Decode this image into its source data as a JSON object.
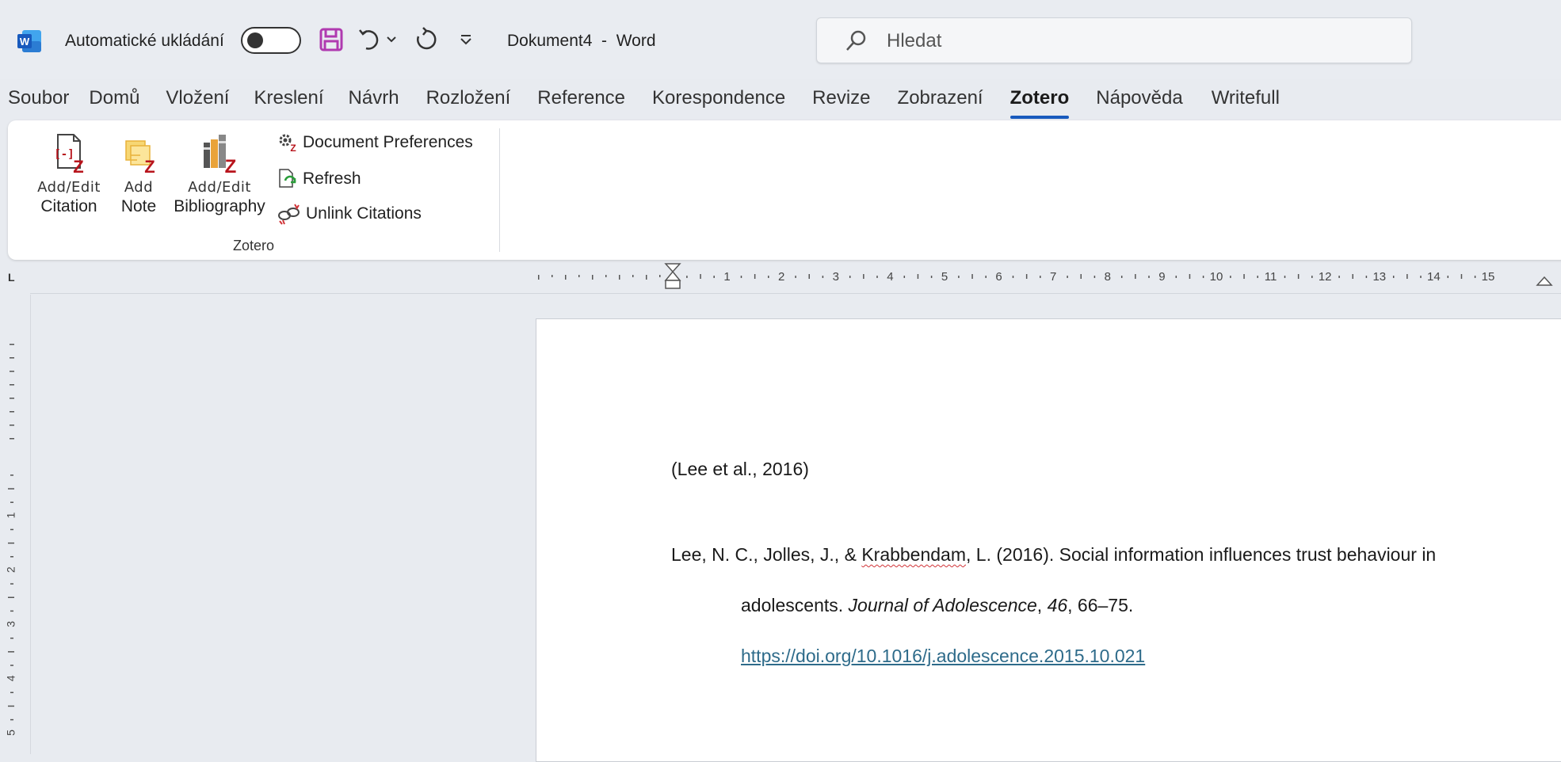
{
  "titlebar": {
    "autosave_label": "Automatické ukládání",
    "document_title": "Dokument4  -  Word",
    "search_placeholder": "Hledat"
  },
  "tabs": [
    {
      "label": "Soubor"
    },
    {
      "label": "Domů"
    },
    {
      "label": "Vložení"
    },
    {
      "label": "Kreslení"
    },
    {
      "label": "Návrh"
    },
    {
      "label": "Rozložení"
    },
    {
      "label": "Reference"
    },
    {
      "label": "Korespondence"
    },
    {
      "label": "Revize"
    },
    {
      "label": "Zobrazení"
    },
    {
      "label": "Zotero",
      "active": true
    },
    {
      "label": "Nápověda"
    },
    {
      "label": "Writefull"
    }
  ],
  "ribbon": {
    "add_edit_citation": {
      "line1": "Add/Edit",
      "line2": "Citation"
    },
    "add_note": {
      "line1": "Add",
      "line2": "Note"
    },
    "add_edit_bibliography": {
      "line1": "Add/Edit",
      "line2": "Bibliography"
    },
    "document_preferences": "Document Preferences",
    "refresh": "Refresh",
    "unlink_citations": "Unlink Citations",
    "group_label": "Zotero"
  },
  "ruler": {
    "h_numbers": [
      "1",
      "2",
      "3",
      "4",
      "5",
      "6",
      "7",
      "8",
      "9",
      "10",
      "11",
      "12",
      "13",
      "14",
      "15"
    ],
    "v_numbers": [
      "1",
      "2",
      "3",
      "4",
      "5"
    ]
  },
  "document": {
    "citation": "(Lee et al., 2016)",
    "bib_line1_pre": "Lee, N. C., Jolles, J., & ",
    "bib_line1_misspelled": "Krabbendam",
    "bib_line1_post": ", L. (2016). Social information influences trust behaviour in",
    "bib_line2_pre": "adolescents. ",
    "bib_journal": "Journal of Adolescence",
    "bib_comma": ", ",
    "bib_volume": "46",
    "bib_pages": ", 66–75.",
    "bib_doi": "https://doi.org/10.1016/j.adolescence.2015.10.021"
  },
  "colors": {
    "word_blue": "#185abd",
    "save_purple": "#b03ab0",
    "zotero_red": "#b8141c",
    "link": "#2e6b8a"
  }
}
